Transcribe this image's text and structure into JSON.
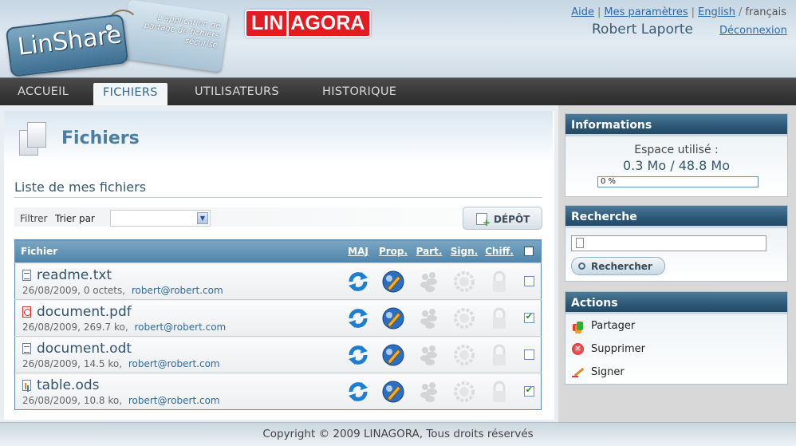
{
  "header": {
    "logo_text": "LinShare",
    "logo_tagline": "L'application de partage de fichiers sécurisé",
    "brand_left": "LIN",
    "brand_right": "AGORA",
    "links": {
      "help": "Aide",
      "settings": "Mes paramètres",
      "english": "English",
      "current_lang": "français"
    },
    "user_name": "Robert Laporte",
    "logout": "Déconnexion"
  },
  "nav": {
    "tabs": [
      "ACCUEIL",
      "FICHIERS",
      "UTILISATEURS",
      "HISTORIQUE"
    ],
    "active": "FICHIERS"
  },
  "page": {
    "title": "Fichiers",
    "list_title": "Liste de mes fichiers",
    "filter_label": "Filtrer",
    "sort_label": "Trier par",
    "sort_value": "",
    "upload_button": "DÉPÔT"
  },
  "table": {
    "headers": {
      "file": "Fichier",
      "update": "MAJ",
      "props": "Prop.",
      "share": "Part.",
      "sign": "Sign.",
      "encrypt": "Chiff."
    },
    "rows": [
      {
        "name": "readme.txt",
        "type": "txt",
        "date": "26/08/2009",
        "size": "0 octets",
        "owner": "robert@robert.com",
        "checked": false
      },
      {
        "name": "document.pdf",
        "type": "pdf",
        "date": "26/08/2009",
        "size": "269.7 ko",
        "owner": "robert@robert.com",
        "checked": true
      },
      {
        "name": "document.odt",
        "type": "odt",
        "date": "26/08/2009",
        "size": "14.5 ko",
        "owner": "robert@robert.com",
        "checked": false
      },
      {
        "name": "table.ods",
        "type": "ods",
        "date": "26/08/2009",
        "size": "10.8 ko",
        "owner": "robert@robert.com",
        "checked": true
      }
    ]
  },
  "sidebar": {
    "info": {
      "title": "Informations",
      "label": "Espace utilisé :",
      "value": "0.3 Mo / 48.8 Mo",
      "progress_text": "0 %",
      "progress_fraction": 0
    },
    "search": {
      "title": "Recherche",
      "value": "",
      "button": "Rechercher"
    },
    "actions": {
      "title": "Actions",
      "items": [
        "Partager",
        "Supprimer",
        "Signer"
      ]
    }
  },
  "footer": {
    "text": "Copyright © 2009 LINAGORA, Tous droits réservés"
  },
  "colors": {
    "nav_bg": "#2b2b2b",
    "accent": "#4a7ea3",
    "box_header": "#2d5877",
    "brand_red": "#e31b23"
  }
}
